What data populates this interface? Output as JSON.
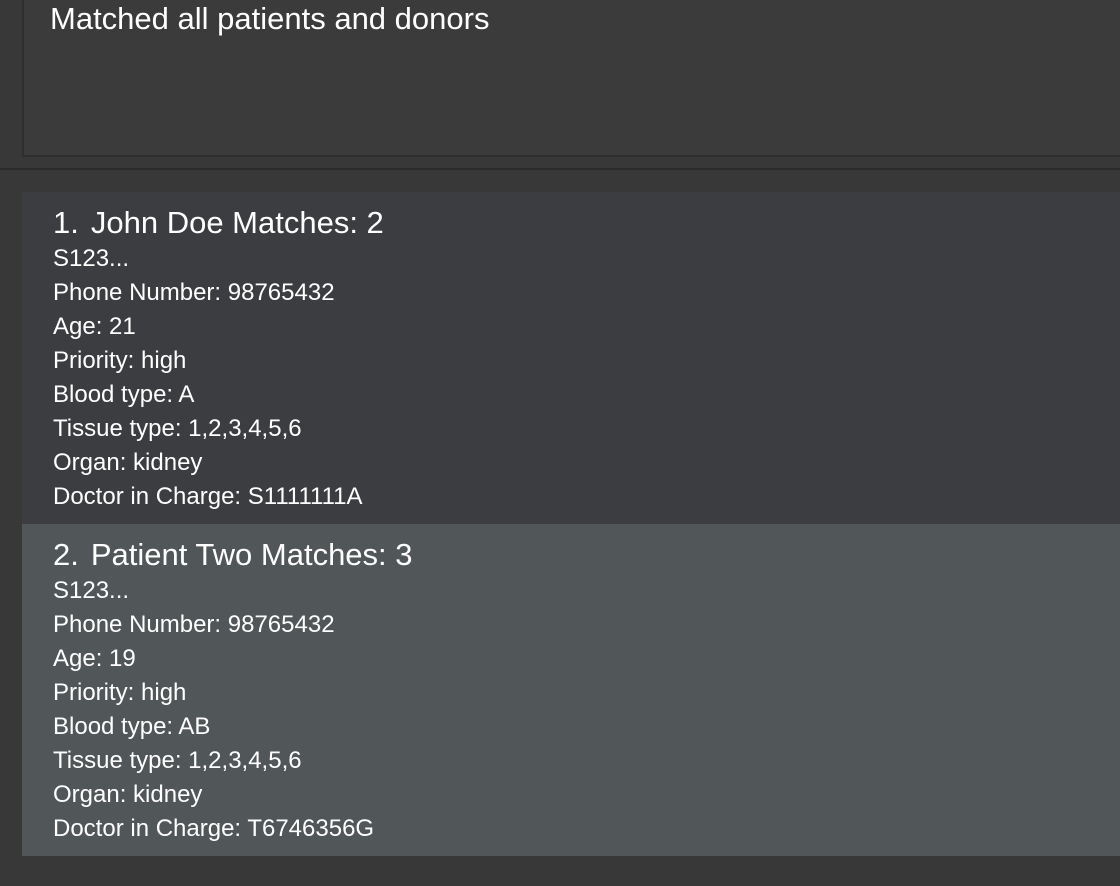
{
  "result": {
    "message": "Matched all patients and donors"
  },
  "patients": [
    {
      "index": "1.",
      "name_matches": "John Doe Matches: 2",
      "nric": "S123...",
      "phone": "Phone Number: 98765432",
      "age": "Age: 21",
      "priority": "Priority: high",
      "blood_type": "Blood type: A",
      "tissue_type": "Tissue type: 1,2,3,4,5,6",
      "organ": "Organ: kidney",
      "doctor": "Doctor in Charge: S1111111A"
    },
    {
      "index": "2.",
      "name_matches": "Patient Two Matches: 3",
      "nric": "S123...",
      "phone": "Phone Number: 98765432",
      "age": "Age: 19",
      "priority": "Priority: high",
      "blood_type": "Blood type: AB",
      "tissue_type": "Tissue type: 1,2,3,4,5,6",
      "organ": "Organ: kidney",
      "doctor": "Doctor in Charge: T6746356G"
    }
  ]
}
